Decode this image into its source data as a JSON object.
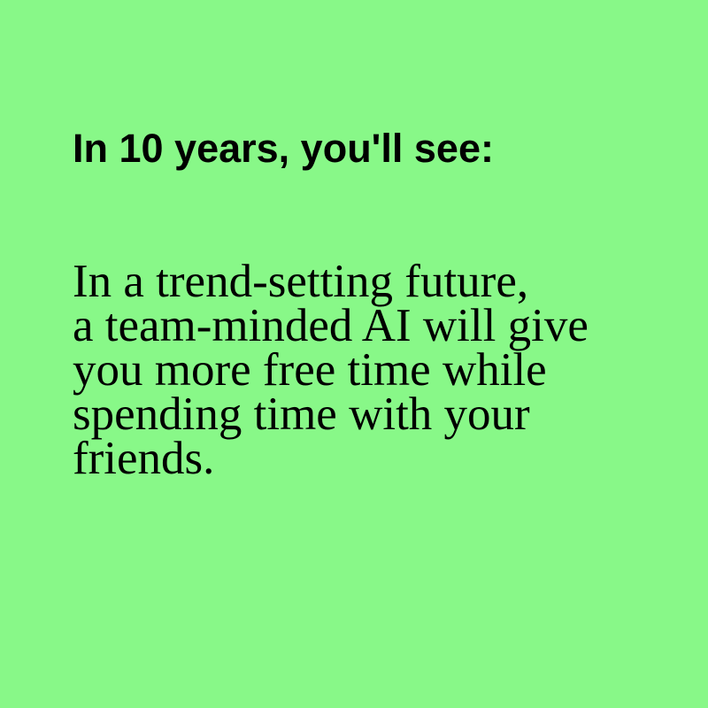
{
  "heading": "In 10 years, you'll see:",
  "body_lines": [
    "In a trend-setting future,",
    "a team-minded AI will give",
    "you more free time while",
    "spending time with your",
    "friends."
  ],
  "colors": {
    "background": "#88f888",
    "text": "#000000"
  }
}
